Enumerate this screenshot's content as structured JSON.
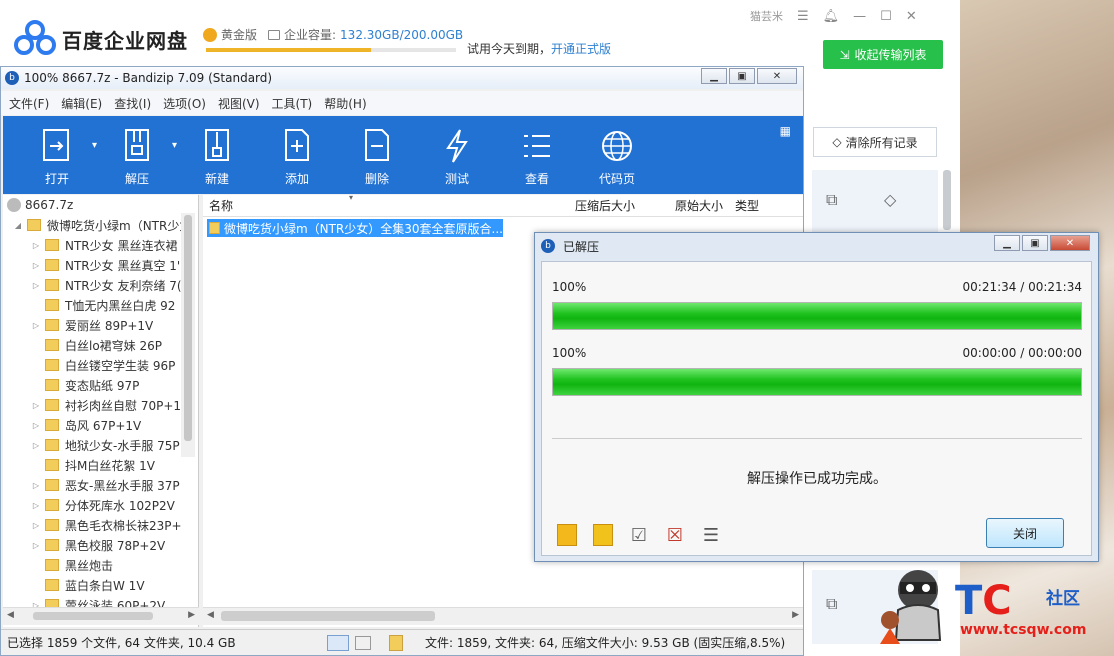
{
  "baidu": {
    "app_name": "百度企业网盘",
    "tier": "黄金版",
    "capacity_label": "企业容量:",
    "capacity_value": "132.30GB/200.00GB",
    "capacity_used_fraction": 0.66,
    "trial_text": "试用今天到期，",
    "trial_link": "开通正式版",
    "collapse_button": "收起传输列表",
    "clear_button": "清除所有记录",
    "win_user": "猫芸米"
  },
  "bandizip": {
    "title": "100% 8667.7z - Bandizip 7.09 (Standard)",
    "menu": [
      "文件(F)",
      "编辑(E)",
      "查找(I)",
      "选项(O)",
      "视图(V)",
      "工具(T)",
      "帮助(H)"
    ],
    "toolbar": {
      "open": "打开",
      "extract": "解压",
      "new": "新建",
      "add": "添加",
      "delete": "删除",
      "test": "测试",
      "view": "查看",
      "codepage": "代码页"
    },
    "tree_root": "8667.7z",
    "tree_items": [
      "微博吃货小绿m（NTR少女",
      "NTR少女 黑丝连衣裙",
      "NTR少女 黑丝真空 1'",
      "NTR少女 友利奈绪 7(",
      "T恤无内黑丝白虎  92",
      "爱丽丝 89P+1V",
      "白丝lo裙穹妹 26P",
      "白丝镂空学生装 96P",
      "变态贴纸 97P",
      "衬衫肉丝自慰 70P+1",
      "岛风 67P+1V",
      "地狱少女-水手服 75P",
      "抖M白丝花絮 1V",
      "恶女-黑丝水手服 37P",
      "分体死库水 102P2V",
      "黑色毛衣棉长袜23P+",
      "黑色校服 78P+2V",
      "黑丝炮击",
      "蓝白条白W 1V",
      "蕾丝泳装 60P+2V"
    ],
    "columns": {
      "name": "名称",
      "packed_size": "压缩后大小",
      "original_size": "原始大小",
      "type": "类型"
    },
    "selected_row": "微博吃货小绿m（NTR少女）全集30套全套原版合...",
    "status_left": "已选择 1859 个文件, 64 文件夹, 10.4 GB",
    "status_right": "文件: 1859, 文件夹: 64, 压缩文件大小: 9.53 GB (固实压缩,8.5%)"
  },
  "dialog": {
    "title": "已解压",
    "progress1_pct": "100%",
    "progress1_time": "00:21:34 / 00:21:34",
    "progress1_value": 1.0,
    "progress2_pct": "100%",
    "progress2_time": "00:00:00 / 00:00:00",
    "progress2_value": 1.0,
    "message": "解压操作已成功完成。",
    "close_button": "关闭"
  },
  "watermark": {
    "tc_t": "T",
    "tc_c": "C",
    "community": "社区",
    "url": "www.tcsqw.com"
  },
  "colors": {
    "baidu_green": "#27c04b",
    "bandizip_blue": "#2272d4",
    "progress_green": "#1fc21f",
    "selection_blue": "#3399ff"
  }
}
